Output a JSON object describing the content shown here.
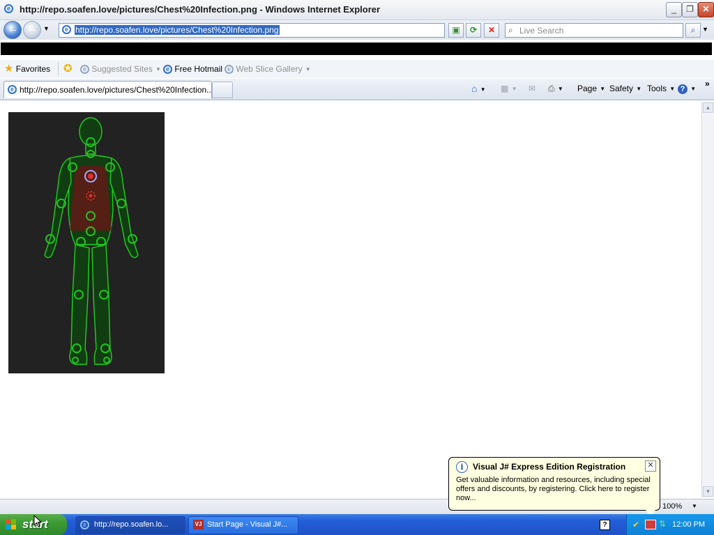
{
  "window": {
    "title": "http://repo.soafen.love/pictures/Chest%20Infection.png - Windows Internet Explorer",
    "minimize_glyph": "_",
    "maximize_glyph": "❐",
    "close_glyph": "✕"
  },
  "address_bar": {
    "url": "http://repo.soafen.love/pictures/Chest%20Infection.png",
    "search_placeholder": "Live Search"
  },
  "favorites_bar": {
    "favorites_label": "Favorites",
    "items": [
      {
        "label": "Suggested Sites",
        "enabled": false
      },
      {
        "label": "Free Hotmail",
        "enabled": true
      },
      {
        "label": "Web Slice Gallery",
        "enabled": false
      }
    ]
  },
  "tab": {
    "label": "http://repo.soafen.love/pictures/Chest%20Infection...."
  },
  "command_bar": {
    "page_label": "Page",
    "safety_label": "Safety",
    "tools_label": "Tools",
    "chevron": "»"
  },
  "status_bar": {
    "zoom": "100%"
  },
  "balloon": {
    "title": "Visual J# Express Edition Registration",
    "body": "Get valuable information and resources, including special offers and discounts, by registering. Click here to register now..."
  },
  "taskbar": {
    "start_label": "start",
    "items": [
      {
        "label": "http://repo.soafen.lo..."
      },
      {
        "label": "Start Page - Visual J#..."
      }
    ],
    "clock": "12:00 PM"
  },
  "colors": {
    "body_outline": "#1fd11f",
    "joint": "#22c422",
    "infection_red": "#e03030",
    "image_bg": "#222222"
  }
}
